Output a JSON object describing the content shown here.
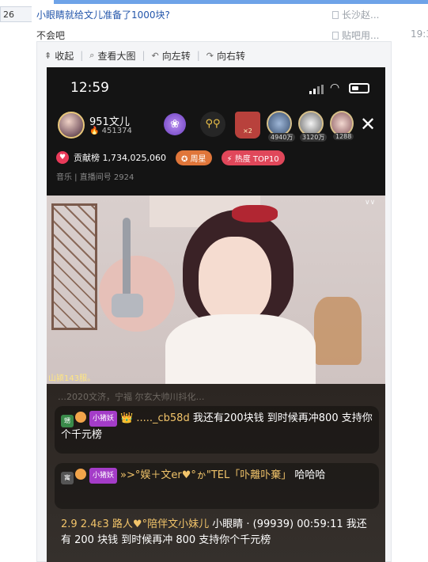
{
  "forum": {
    "row_number": "26",
    "post_title": "小眼睛就给文儿准备了1000块?",
    "post_author": "长沙赵...",
    "reply_text": "不会吧",
    "reply_author": "贴吧用...",
    "reply_time": "19:3"
  },
  "viewer_toolbar": {
    "collapse": "收起",
    "view_large": "查看大图",
    "rotate_left": "向左转",
    "rotate_right": "向右转"
  },
  "stream": {
    "clock": "12:59",
    "anchor_name": "951文儿",
    "anchor_fans": "451374",
    "rank_badge_text": "×2",
    "viewer_counts": [
      "4940万",
      "3120万",
      "1288"
    ],
    "contrib_label": "贡献榜",
    "contrib_value": "1,734,025,060",
    "star_label": "周星",
    "hot_label": "热度 TOP10",
    "meta_text": "音乐 | 直播间号 2924",
    "video_caption": "山颍143服。",
    "video_corner": "∨∨"
  },
  "chat": {
    "faded_line": "…2020文济，宁福 尔玄大帅川抖化…",
    "msg1_level": "甥",
    "msg1_tag": "小猪妖",
    "msg1_nick": "....._cb58d",
    "msg1_text": "我还有200块钱 到时候再冲800 支持你个千元榜",
    "msg2_level": "寓",
    "msg2_tag": "小猪妖",
    "msg2_nick": "»>°娱＋文er♥°ゕ\"TEL「卟離卟棄」",
    "msg2_text": "哈哈哈",
    "msg3_levels": "2.9 2.4ε3",
    "msg3_nick": "路人♥°陪伴文小妹儿",
    "msg3_text": "小眼睛 · (99939) 00:59:11 我还有 200 块钱 到时候再冲 800 支持你个千元榜"
  }
}
